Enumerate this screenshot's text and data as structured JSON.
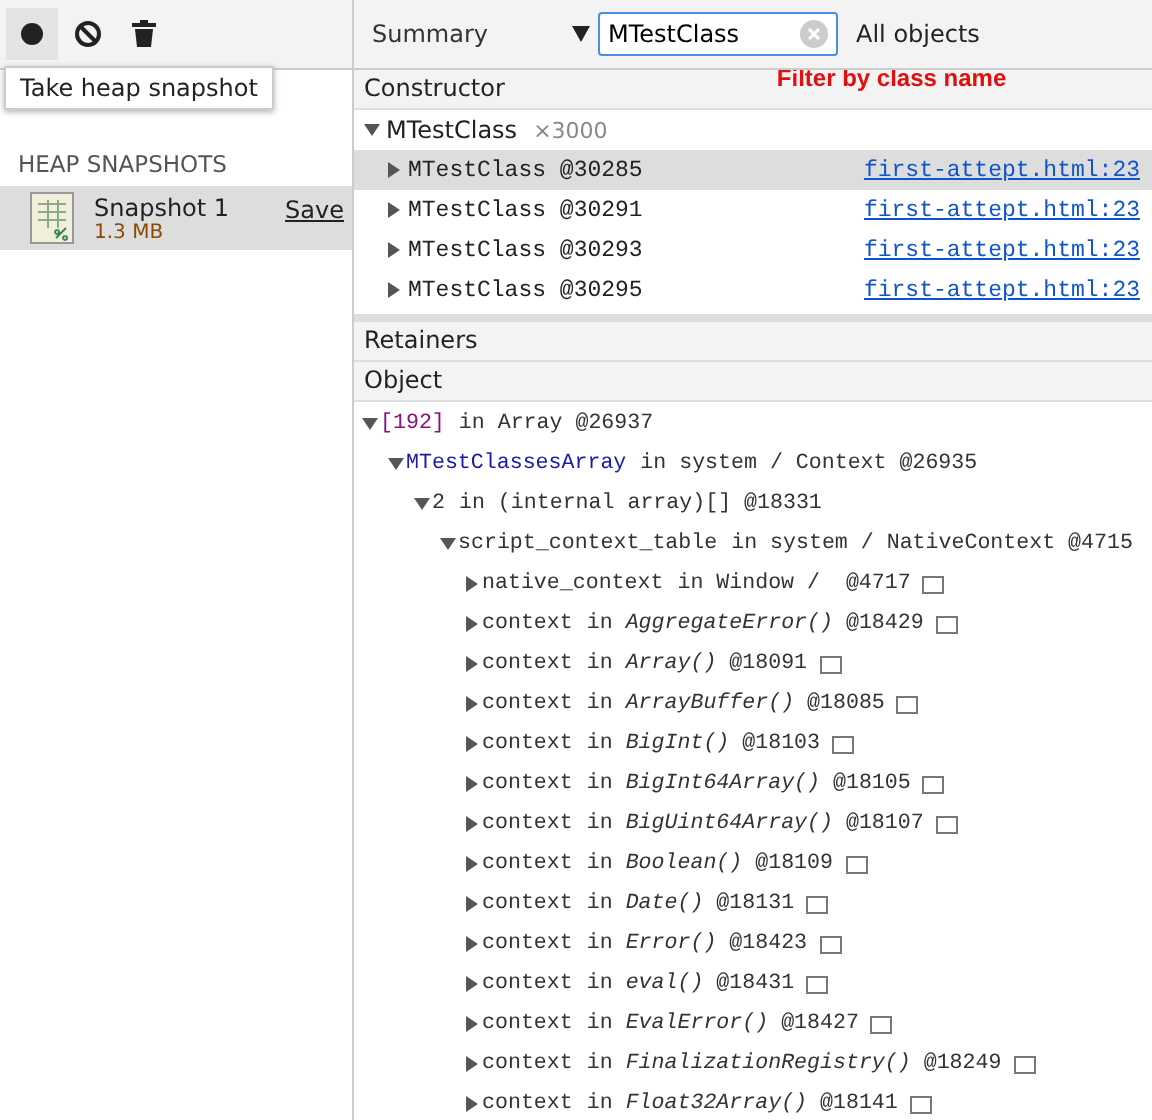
{
  "sidebar": {
    "toolbar": [
      {
        "kind": "record",
        "hovered": true
      },
      {
        "kind": "clear",
        "hovered": false
      },
      {
        "kind": "delete",
        "hovered": false
      }
    ],
    "tooltip": "Take heap snapshot",
    "section_title": "HEAP SNAPSHOTS",
    "snapshots": [
      {
        "title": "Snapshot 1",
        "size": "1.3 MB",
        "save": "Save",
        "selected": true
      }
    ]
  },
  "toolbar": {
    "view": "Summary",
    "filter": {
      "value": "MTestClass"
    },
    "scope": "All objects"
  },
  "annotation": "Filter by class name",
  "constructors": {
    "header": "Constructor",
    "groups": [
      {
        "name": "MTestClass",
        "count": "×3000",
        "expanded": true,
        "instances": [
          {
            "name": "MTestClass @30285",
            "link": "first-attept.html:23",
            "selected": true
          },
          {
            "name": "MTestClass @30291",
            "link": "first-attept.html:23",
            "selected": false
          },
          {
            "name": "MTestClass @30293",
            "link": "first-attept.html:23",
            "selected": false
          },
          {
            "name": "MTestClass @30295",
            "link": "first-attept.html:23",
            "selected": false
          }
        ]
      }
    ]
  },
  "retainers": {
    "title": "Retainers",
    "header": "Object",
    "tree": [
      {
        "name": "[192]",
        "kind": "index",
        "detail": "in Array @26937",
        "expanded": true,
        "reveal_icon": false,
        "children": [
          {
            "name": "MTestClassesArray",
            "kind": "property",
            "detail": "in system / Context @26935",
            "expanded": true,
            "reveal_icon": false,
            "children": [
              {
                "name": "2",
                "kind": "plain",
                "detail": "in (internal array)[] @18331",
                "expanded": true,
                "reveal_icon": false,
                "children": [
                  {
                    "name": "script_context_table",
                    "kind": "plain",
                    "detail": "in system / NativeContext @4715",
                    "expanded": true,
                    "reveal_icon": false,
                    "children": [
                      {
                        "name": "native_context",
                        "kind": "plain",
                        "detail": "in Window /  @4717",
                        "expanded": false,
                        "reveal_icon": true
                      },
                      {
                        "name": "context",
                        "kind": "plain",
                        "detail": "in *AggregateError()* @18429",
                        "expanded": false,
                        "reveal_icon": true
                      },
                      {
                        "name": "context",
                        "kind": "plain",
                        "detail": "in *Array()* @18091",
                        "expanded": false,
                        "reveal_icon": true
                      },
                      {
                        "name": "context",
                        "kind": "plain",
                        "detail": "in *ArrayBuffer()* @18085",
                        "expanded": false,
                        "reveal_icon": true
                      },
                      {
                        "name": "context",
                        "kind": "plain",
                        "detail": "in *BigInt()* @18103",
                        "expanded": false,
                        "reveal_icon": true
                      },
                      {
                        "name": "context",
                        "kind": "plain",
                        "detail": "in *BigInt64Array()* @18105",
                        "expanded": false,
                        "reveal_icon": true
                      },
                      {
                        "name": "context",
                        "kind": "plain",
                        "detail": "in *BigUint64Array()* @18107",
                        "expanded": false,
                        "reveal_icon": true
                      },
                      {
                        "name": "context",
                        "kind": "plain",
                        "detail": "in *Boolean()* @18109",
                        "expanded": false,
                        "reveal_icon": true
                      },
                      {
                        "name": "context",
                        "kind": "plain",
                        "detail": "in *Date()* @18131",
                        "expanded": false,
                        "reveal_icon": true
                      },
                      {
                        "name": "context",
                        "kind": "plain",
                        "detail": "in *Error()* @18423",
                        "expanded": false,
                        "reveal_icon": true
                      },
                      {
                        "name": "context",
                        "kind": "plain",
                        "detail": "in *eval()* @18431",
                        "expanded": false,
                        "reveal_icon": true
                      },
                      {
                        "name": "context",
                        "kind": "plain",
                        "detail": "in *EvalError()* @18427",
                        "expanded": false,
                        "reveal_icon": true
                      },
                      {
                        "name": "context",
                        "kind": "plain",
                        "detail": "in *FinalizationRegistry()* @18249",
                        "expanded": false,
                        "reveal_icon": true
                      },
                      {
                        "name": "context",
                        "kind": "plain",
                        "detail": "in *Float32Array()* @18141",
                        "expanded": false,
                        "reveal_icon": true
                      }
                    ]
                  }
                ]
              }
            ]
          }
        ]
      }
    ]
  }
}
